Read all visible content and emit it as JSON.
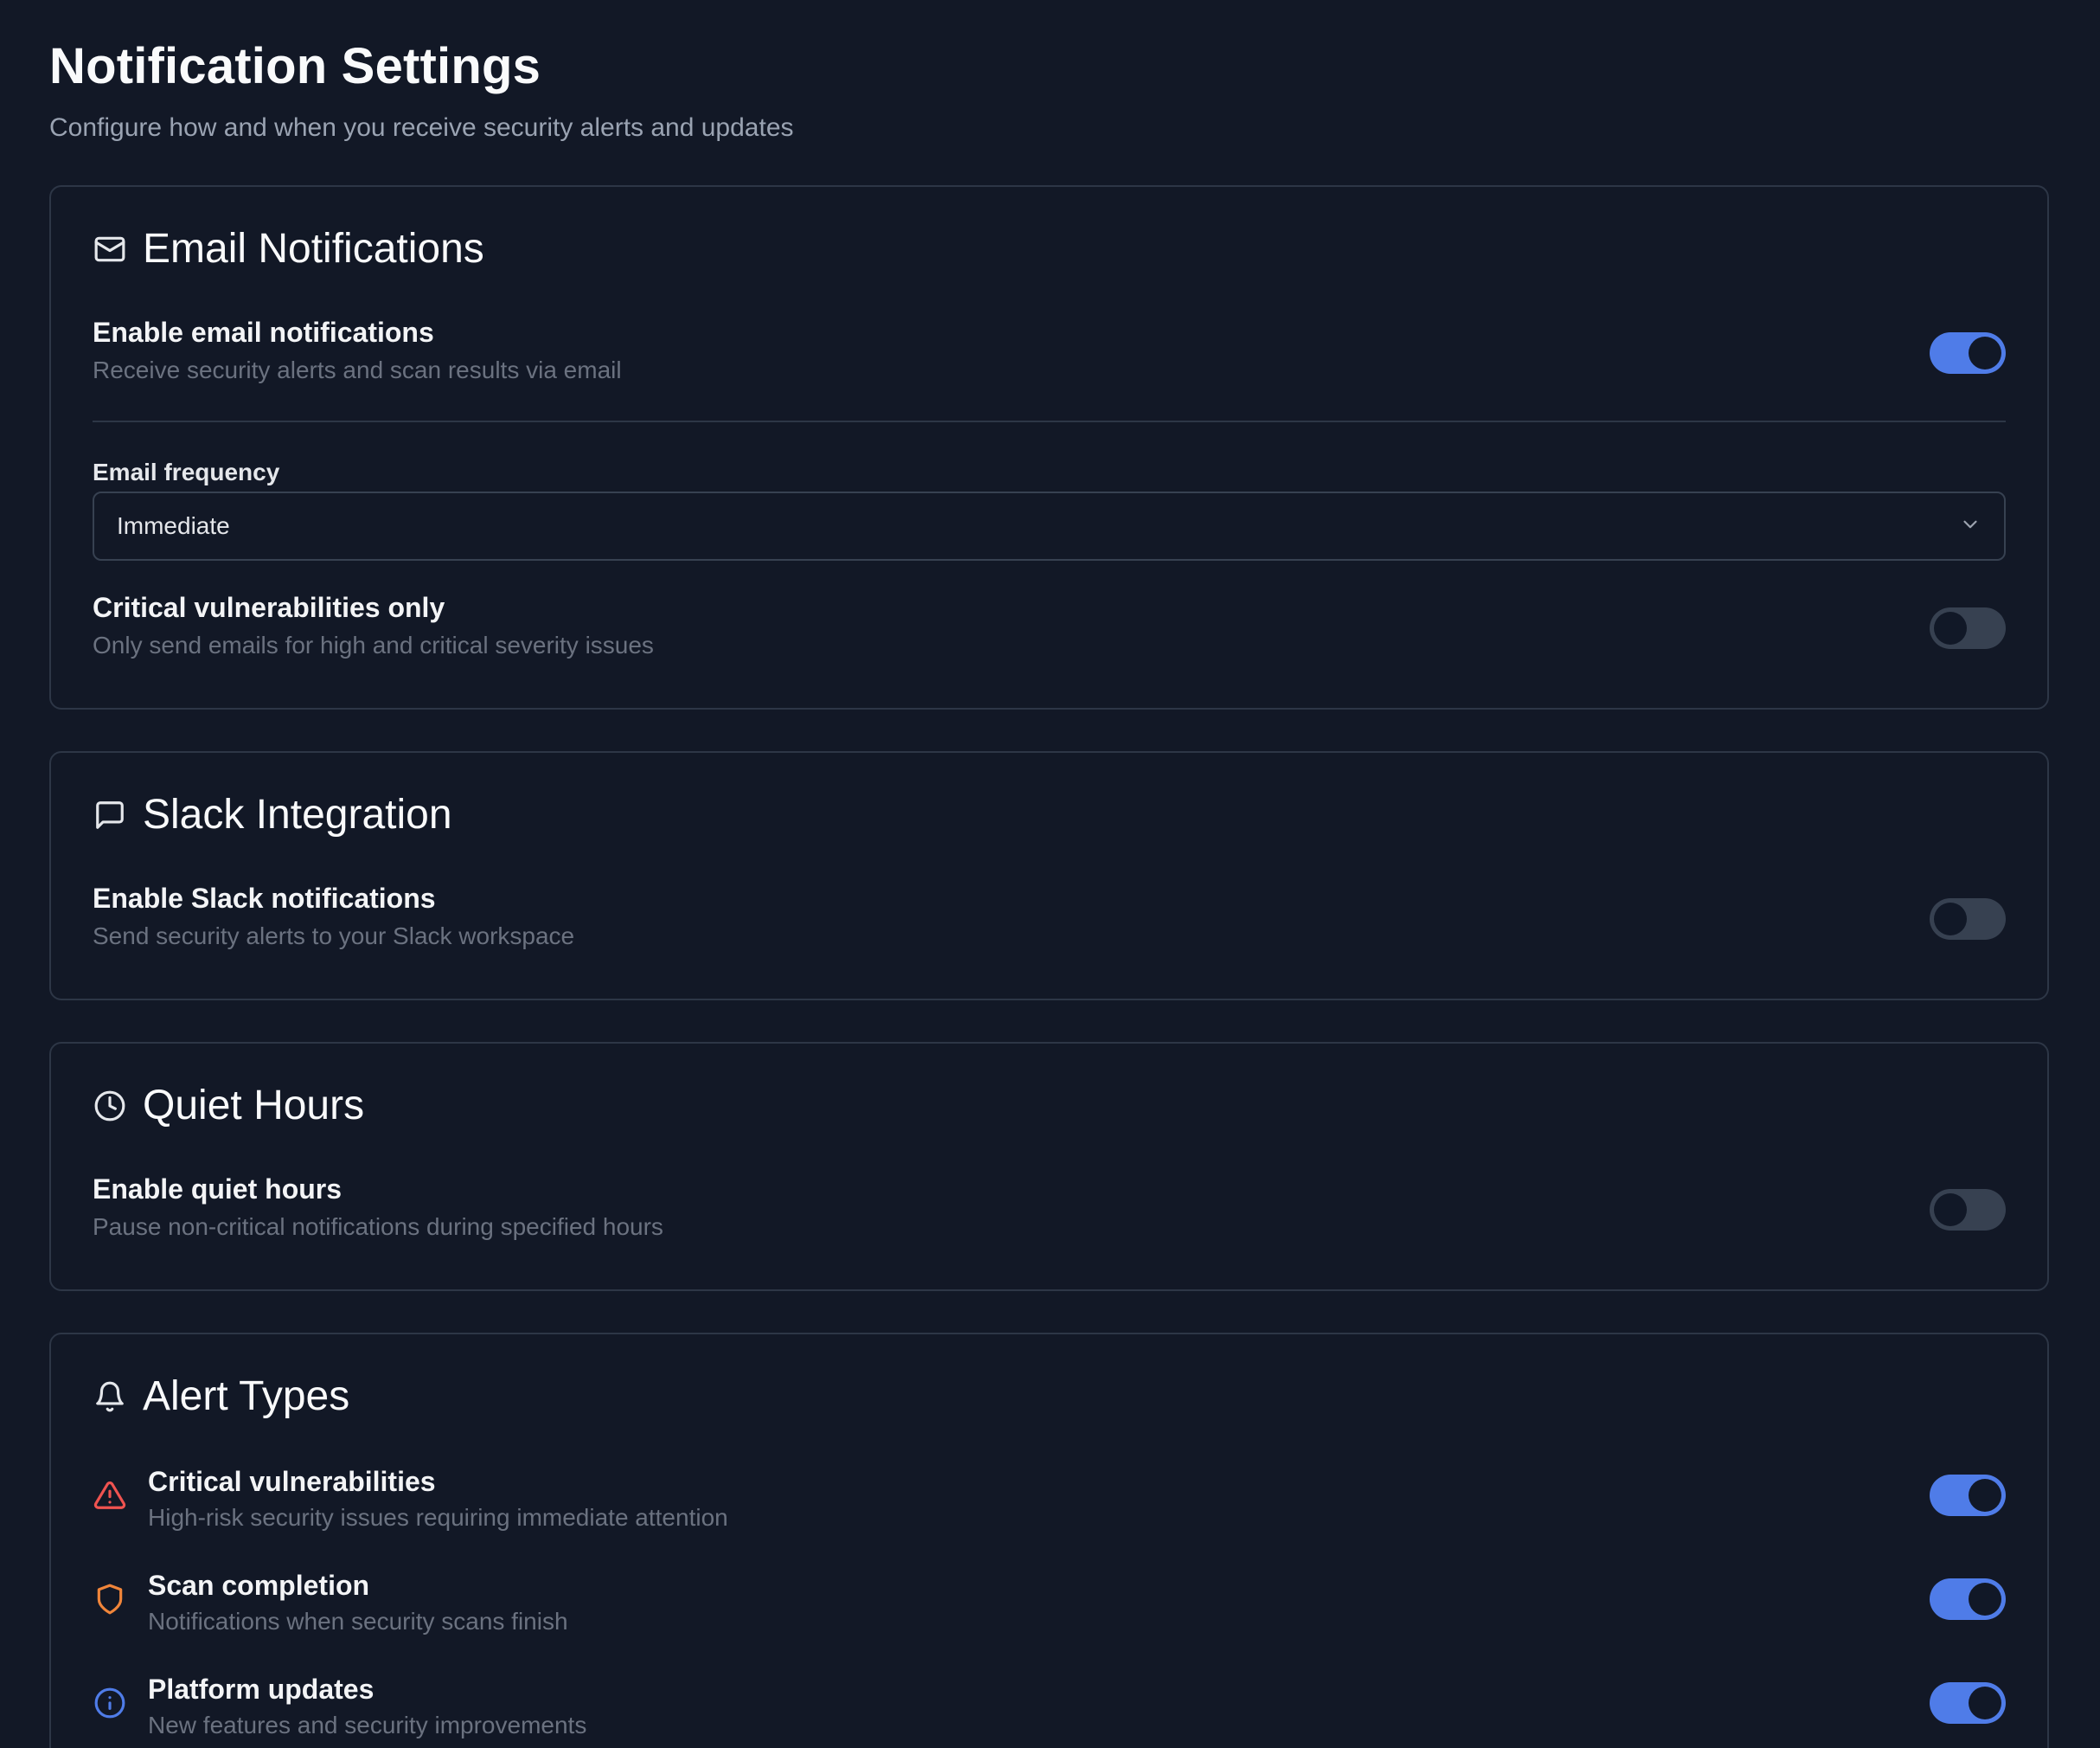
{
  "header": {
    "title": "Notification Settings",
    "subtitle": "Configure how and when you receive security alerts and updates"
  },
  "email": {
    "title": "Email Notifications",
    "icon": "mail-icon",
    "enable": {
      "label": "Enable email notifications",
      "desc": "Receive security alerts and scan results via email",
      "on": true
    },
    "frequency": {
      "label": "Email frequency",
      "value": "Immediate"
    },
    "critical_only": {
      "label": "Critical vulnerabilities only",
      "desc": "Only send emails for high and critical severity issues",
      "on": false
    }
  },
  "slack": {
    "title": "Slack Integration",
    "icon": "message-square-icon",
    "enable": {
      "label": "Enable Slack notifications",
      "desc": "Send security alerts to your Slack workspace",
      "on": false
    }
  },
  "quiet": {
    "title": "Quiet Hours",
    "icon": "clock-icon",
    "enable": {
      "label": "Enable quiet hours",
      "desc": "Pause non-critical notifications during specified hours",
      "on": false
    }
  },
  "alerts": {
    "title": "Alert Types",
    "icon": "bell-icon",
    "items": [
      {
        "label": "Critical vulnerabilities",
        "desc": "High-risk security issues requiring immediate attention",
        "icon": "alert-triangle-icon",
        "color": "#ef5350",
        "on": true
      },
      {
        "label": "Scan completion",
        "desc": "Notifications when security scans finish",
        "icon": "shield-icon",
        "color": "#f0853a",
        "on": true
      },
      {
        "label": "Platform updates",
        "desc": "New features and security improvements",
        "icon": "info-icon",
        "color": "#4f7ce8",
        "on": true
      }
    ]
  },
  "colors": {
    "background": "#121826",
    "accent": "#4f7ce8",
    "border": "#2d3646"
  }
}
